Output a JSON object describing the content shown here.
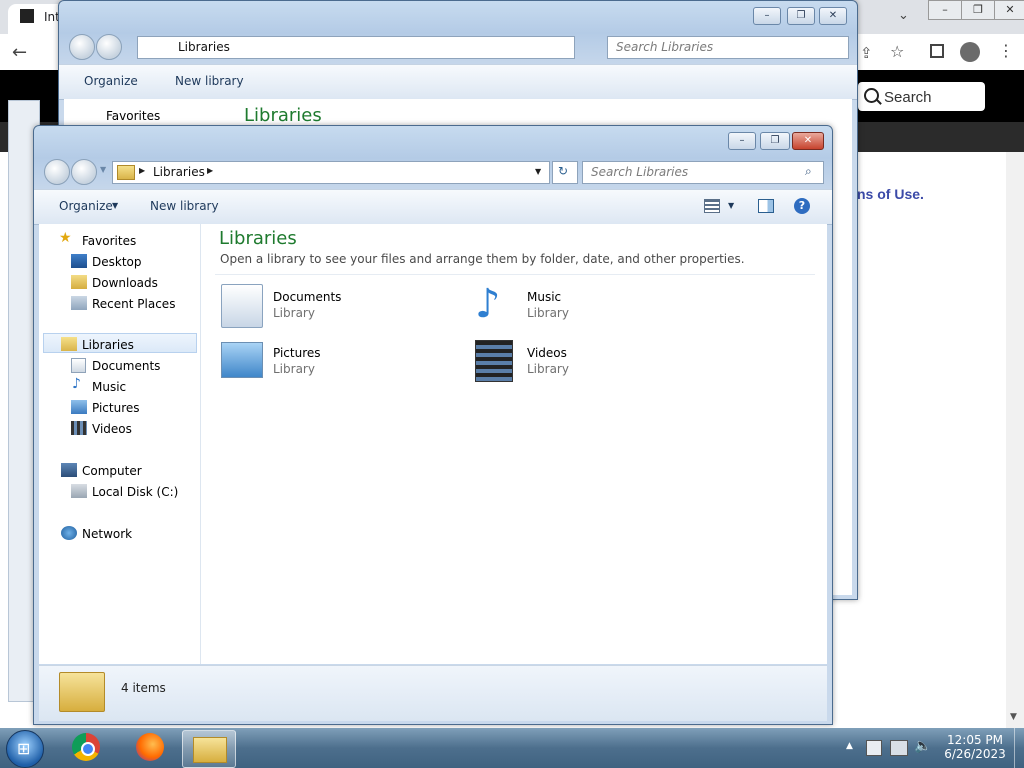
{
  "browser": {
    "tab_title": "Int",
    "search_label": "Search",
    "terms_text": "ns of Use."
  },
  "back_window": {
    "address": "Libraries",
    "search_placeholder": "Search Libraries",
    "organize_label": "Organize",
    "new_library_label": "New library",
    "favorites_label": "Favorites",
    "heading": "Libraries"
  },
  "explorer": {
    "address": "Libraries",
    "search_placeholder": "Search Libraries",
    "toolbar": {
      "organize_label": "Organize",
      "new_library_label": "New library"
    },
    "nav": {
      "favorites": {
        "label": "Favorites",
        "items": [
          "Desktop",
          "Downloads",
          "Recent Places"
        ]
      },
      "libraries": {
        "label": "Libraries",
        "items": [
          "Documents",
          "Music",
          "Pictures",
          "Videos"
        ]
      },
      "computer": {
        "label": "Computer",
        "items": [
          "Local Disk (C:)"
        ]
      },
      "network": {
        "label": "Network"
      }
    },
    "heading": "Libraries",
    "description": "Open a library to see your files and arrange them by folder, date, and other properties.",
    "libraries": [
      {
        "name": "Documents",
        "type": "Library"
      },
      {
        "name": "Music",
        "type": "Library"
      },
      {
        "name": "Pictures",
        "type": "Library"
      },
      {
        "name": "Videos",
        "type": "Library"
      }
    ],
    "status": "4 items"
  },
  "taskbar": {
    "time": "12:05 PM",
    "date": "6/26/2023"
  },
  "colors": {
    "heading_green": "#1e7a2e",
    "taskbar": "#4d6f8d",
    "terms_link": "#3b4aa8"
  }
}
